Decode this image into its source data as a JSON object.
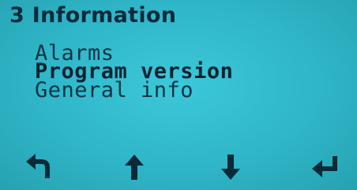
{
  "screen": {
    "title": "3 Information",
    "selected_index": 1,
    "menu": [
      {
        "label": "Alarms"
      },
      {
        "label": "Program version"
      },
      {
        "label": "General info"
      }
    ]
  },
  "softkeys": [
    {
      "icon": "back-arrow-icon"
    },
    {
      "icon": "arrow-up-icon"
    },
    {
      "icon": "arrow-down-icon"
    },
    {
      "icon": "enter-icon"
    }
  ],
  "colors": {
    "lcd_background": "#2fb6c8",
    "lcd_text": "#0a2a38"
  }
}
